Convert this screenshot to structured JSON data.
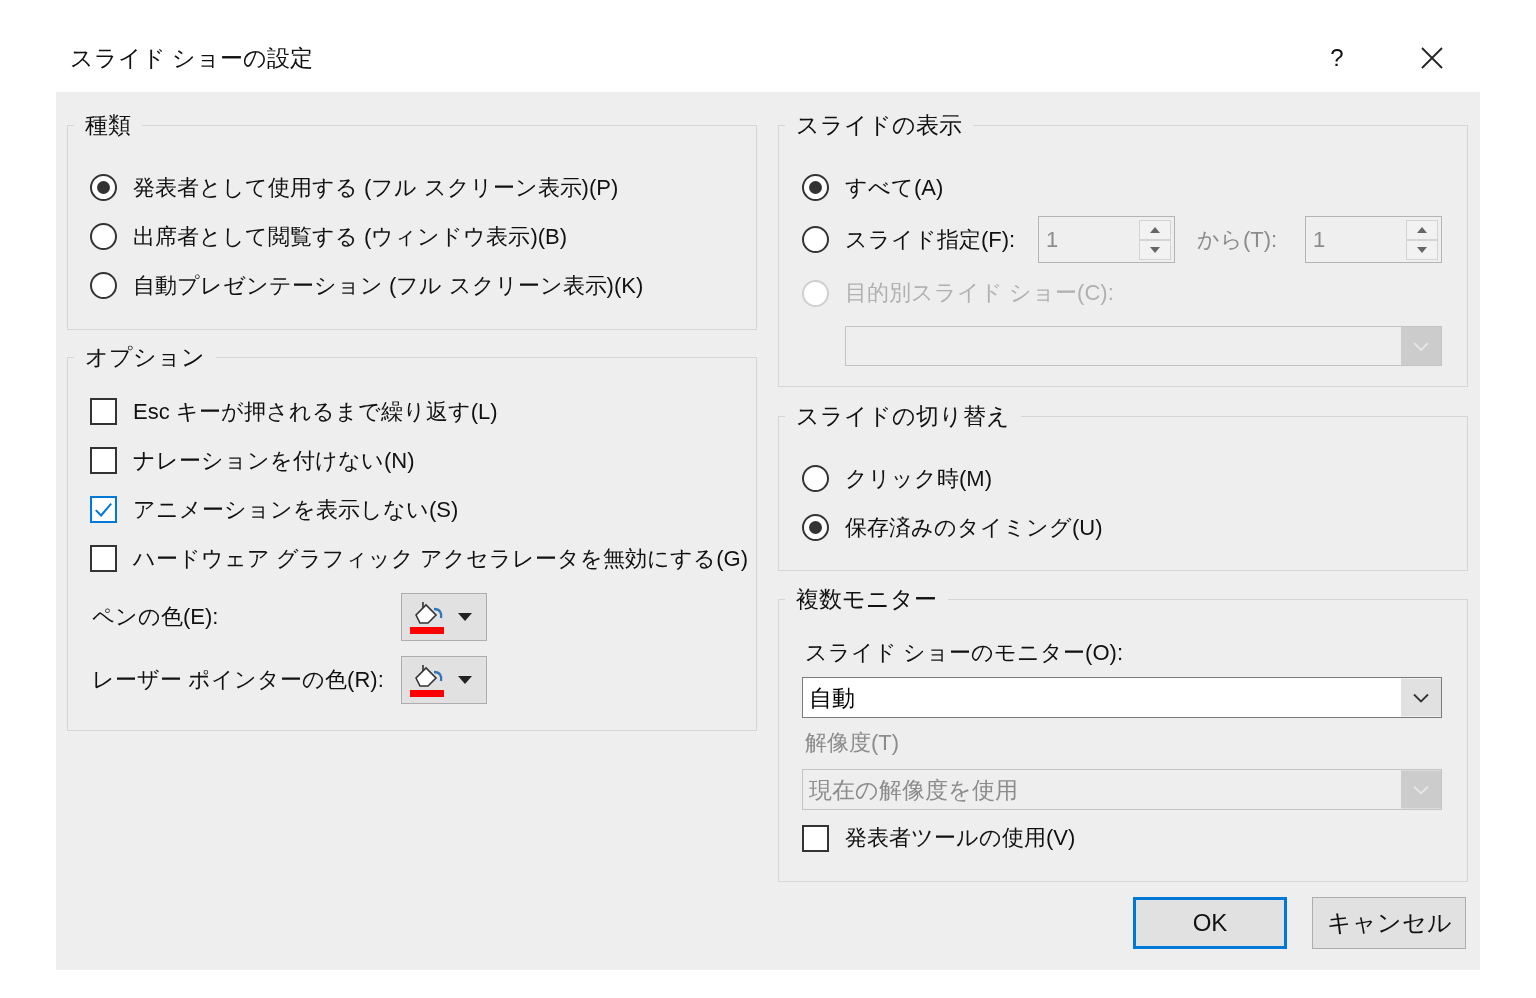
{
  "window": {
    "title": "スライド ショーの設定",
    "help": "?"
  },
  "show_type": {
    "title": "種類",
    "options": [
      {
        "label": "発表者として使用する (フル スクリーン表示)(P)",
        "selected": true
      },
      {
        "label": "出席者として閲覧する (ウィンドウ表示)(B)",
        "selected": false
      },
      {
        "label": "自動プレゼンテーション (フル スクリーン表示)(K)",
        "selected": false
      }
    ]
  },
  "show_options": {
    "title": "オプション",
    "checkboxes": [
      {
        "label": "Esc キーが押されるまで繰り返す(L)",
        "checked": false
      },
      {
        "label": "ナレーションを付けない(N)",
        "checked": false
      },
      {
        "label": "アニメーションを表示しない(S)",
        "checked": true
      },
      {
        "label": "ハードウェア グラフィック アクセラレータを無効にする(G)",
        "checked": false
      }
    ],
    "colors": [
      {
        "label": "ペンの色(E):",
        "color": "#ff0000"
      },
      {
        "label": "レーザー ポインターの色(R):",
        "color": "#ff0000"
      }
    ]
  },
  "show_slides": {
    "title": "スライドの表示",
    "options": [
      {
        "kind": "all",
        "label": "すべて(A)",
        "selected": true,
        "disabled": false
      },
      {
        "kind": "range",
        "label": "スライド指定(F):",
        "selected": false,
        "disabled": false,
        "range": {
          "disabled": true,
          "from": "1",
          "to_label": "から(T):",
          "to": "1"
        }
      },
      {
        "kind": "custom_show",
        "label": "目的別スライド ショー(C):",
        "selected": false,
        "disabled": true,
        "dropdown": {
          "disabled": true
        }
      }
    ]
  },
  "advance_slides": {
    "title": "スライドの切り替え",
    "options": [
      {
        "label": "クリック時(M)",
        "selected": false
      },
      {
        "label": "保存済みのタイミング(U)",
        "selected": true
      }
    ]
  },
  "multiple_monitors": {
    "title": "複数モニター",
    "monitor": {
      "label": "スライド ショーのモニター(O):",
      "value": "自動",
      "disabled": false
    },
    "resolution": {
      "label": "解像度(T)",
      "value": "現在の解像度を使用",
      "disabled": true
    },
    "presenter_view": {
      "label": "発表者ツールの使用(V)",
      "checked": false
    }
  },
  "buttons": [
    {
      "label": "OK",
      "default": true
    },
    {
      "label": "キャンセル",
      "default": false
    }
  ]
}
